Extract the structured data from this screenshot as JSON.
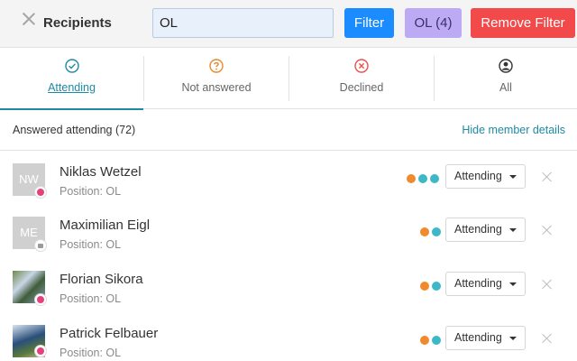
{
  "header": {
    "title": "Recipients",
    "search_value": "OL",
    "filter_label": "Filter",
    "ol_filter_label": "OL (4)",
    "remove_filter_label": "Remove Filter"
  },
  "tabs": [
    {
      "label": "Attending",
      "icon": "check-circle-icon",
      "color": "#1f8aa3",
      "active": true
    },
    {
      "label": "Not answered",
      "icon": "question-circle-icon",
      "color": "#e8892b",
      "active": false
    },
    {
      "label": "Declined",
      "icon": "x-circle-icon",
      "color": "#e8504a",
      "active": false
    },
    {
      "label": "All",
      "icon": "person-circle-icon",
      "color": "#333333",
      "active": false
    }
  ],
  "section": {
    "count_label": "Answered attending (72)",
    "hide_details_label": "Hide member details"
  },
  "members": [
    {
      "initials": "NW",
      "name": "Niklas Wetzel",
      "position": "Position: OL",
      "status": "Attending",
      "badge": "app-icon",
      "dots": [
        "#f08a2c",
        "#3cb8c8",
        "#3cb8c8"
      ]
    },
    {
      "initials": "ME",
      "name": "Maximilian Eigl",
      "position": "Position: OL",
      "status": "Attending",
      "badge": "mail-icon",
      "dots": [
        "#f08a2c",
        "#3cb8c8"
      ]
    },
    {
      "initials": "",
      "name": "Florian Sikora",
      "position": "Position: OL",
      "status": "Attending",
      "badge": "app-icon",
      "dots": [
        "#f08a2c",
        "#3cb8c8"
      ]
    },
    {
      "initials": "",
      "name": "Patrick Felbauer",
      "position": "Position: OL",
      "status": "Attending",
      "badge": "app-icon",
      "dots": [
        "#f08a2c",
        "#3cb8c8"
      ]
    }
  ],
  "colors": {
    "accent": "#1f8aa3",
    "filter_button": "#1a8cff",
    "ol_button": "#bcaaf5",
    "remove_button": "#f24a4a"
  }
}
